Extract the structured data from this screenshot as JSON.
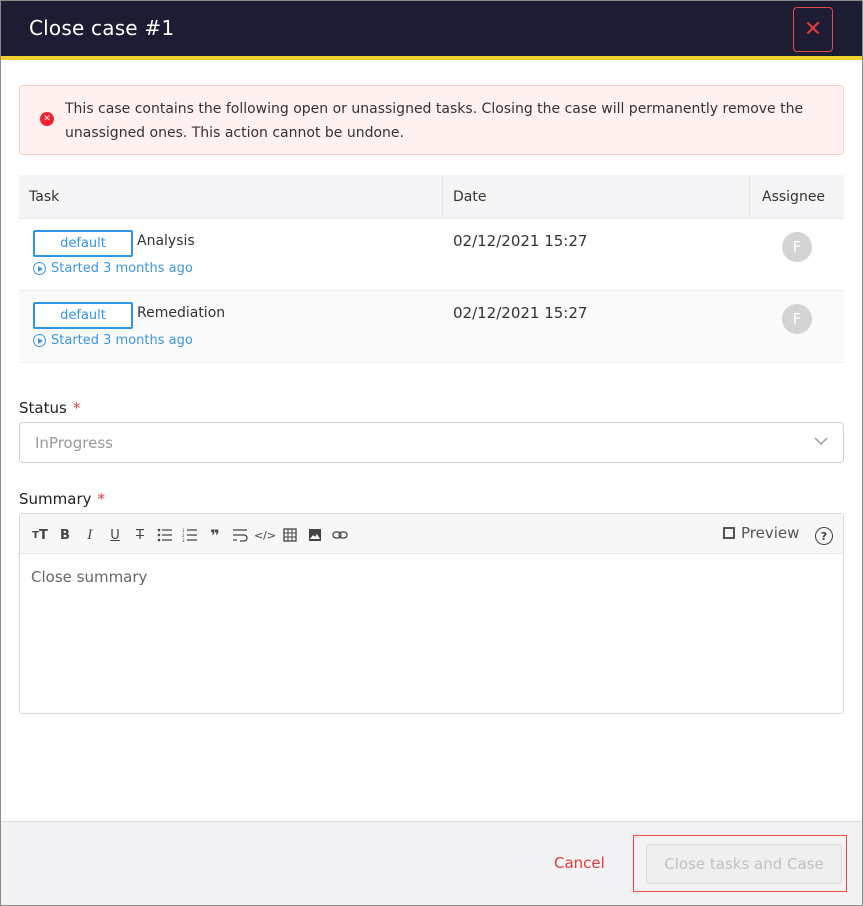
{
  "dialog": {
    "title": "Close case #1",
    "close_icon": "close-icon"
  },
  "alert": {
    "icon": "error-circle-icon",
    "message": "This case contains the following open or unassigned tasks. Closing the case will permanently remove the unassigned ones. This action cannot be undone."
  },
  "tasks": {
    "columns": {
      "task": "Task",
      "date": "Date",
      "assignee": "Assignee"
    },
    "rows": [
      {
        "tag": "default",
        "name": "Analysis",
        "status": "Started 3 months ago",
        "date": "02/12/2021 15:27",
        "assignee_initial": "F"
      },
      {
        "tag": "default",
        "name": "Remediation",
        "status": "Started 3 months ago",
        "date": "02/12/2021 15:27",
        "assignee_initial": "F"
      }
    ]
  },
  "status_field": {
    "label": "Status",
    "required_mark": "*",
    "value": "InProgress"
  },
  "summary_field": {
    "label": "Summary",
    "required_mark": "*",
    "placeholder": "Close summary",
    "preview_label": "Preview",
    "toolbar": [
      "header-icon",
      "bold-icon",
      "italic-icon",
      "underline-icon",
      "strikethrough-icon",
      "bullet-list-icon",
      "numbered-list-icon",
      "quote-icon",
      "wrap-icon",
      "code-icon",
      "table-icon",
      "image-icon",
      "link-icon"
    ]
  },
  "footer": {
    "cancel_label": "Cancel",
    "submit_label": "Close tasks and Case"
  },
  "colors": {
    "header_bg": "#1c1c33",
    "header_accent": "#f0d22e",
    "danger": "#e53935",
    "link_blue": "#2f95e8"
  }
}
